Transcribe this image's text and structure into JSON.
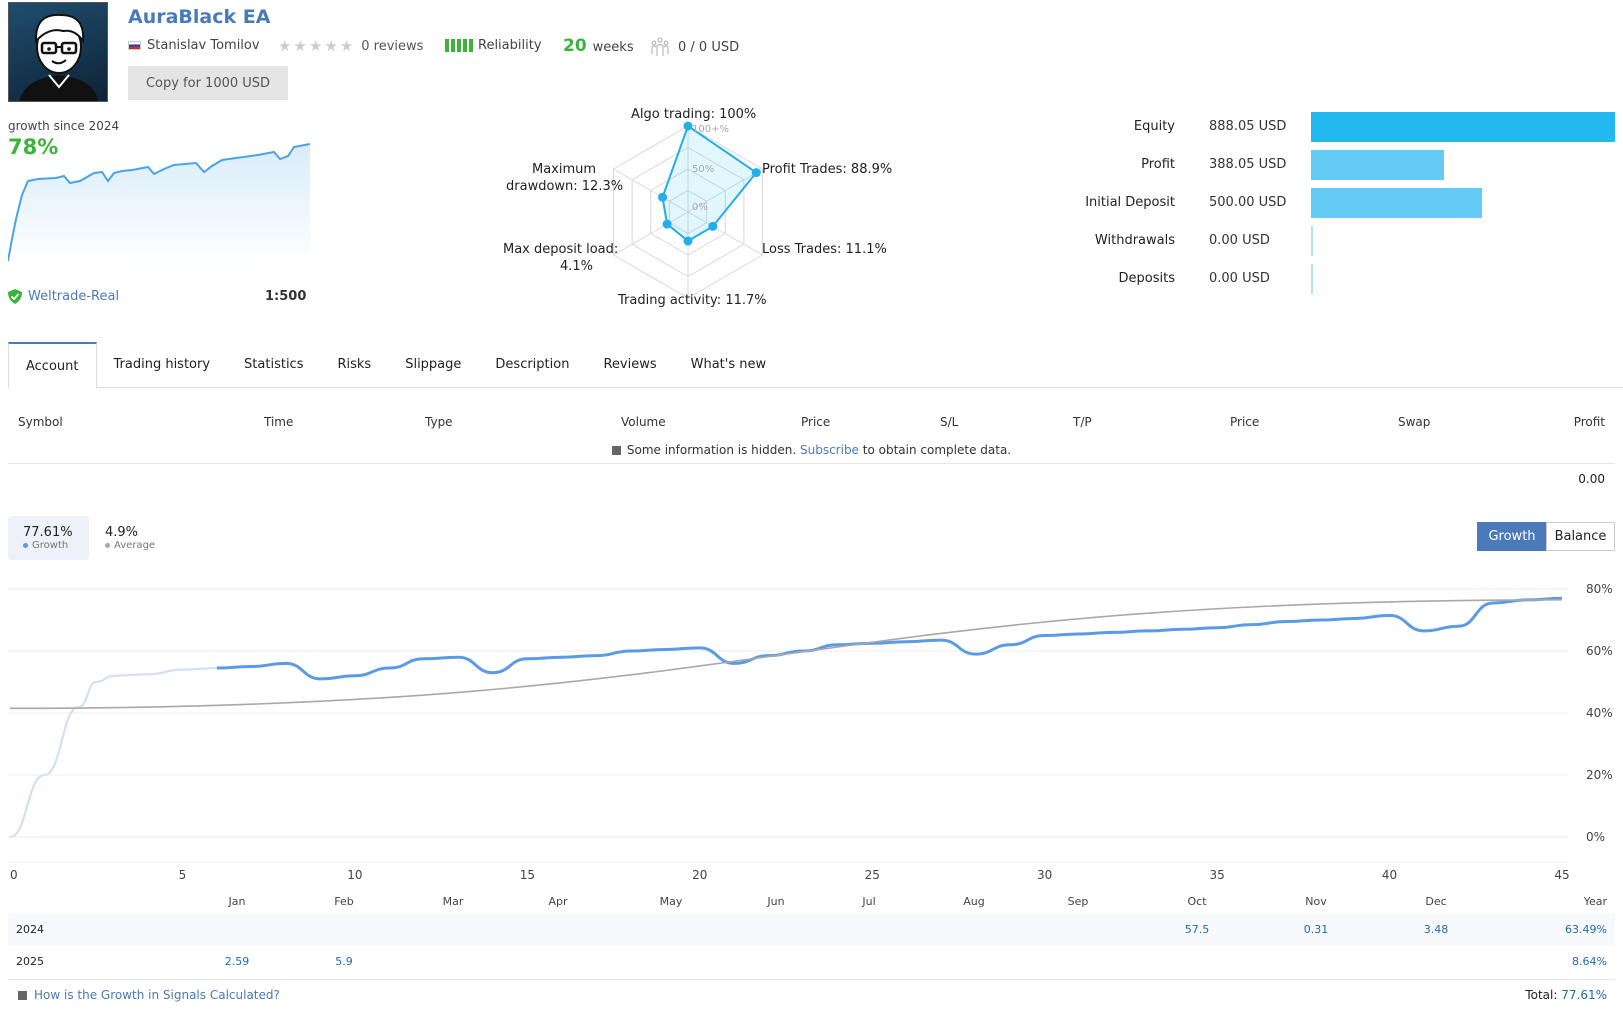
{
  "header": {
    "title": "AuraBlack EA",
    "author": "Stanislav Tomilov",
    "reviews": "0 reviews",
    "rating_stars": 0,
    "reliability_label": "Reliability",
    "reliability_bars": 5,
    "weeks_value": "20",
    "weeks_label": "weeks",
    "subscribers": "0 / 0 USD",
    "copy_button": "Copy for 1000 USD"
  },
  "summary": {
    "growth_label": "growth since 2024",
    "growth_value": "78%",
    "broker": "Weltrade-Real",
    "leverage": "1:500"
  },
  "radar": {
    "labels": {
      "algo": "Algo trading: 100%",
      "profit": "Profit Trades: 88.9%",
      "loss": "Loss Trades: 11.1%",
      "activity": "Trading activity: 11.7%",
      "load_1": "Max deposit load:",
      "load_2": "4.1%",
      "dd_1": "Maximum",
      "dd_2": "drawdown: 12.3%"
    },
    "scale": {
      "top": "100+%",
      "mid": "50%",
      "zero": "0%"
    },
    "values": {
      "algo": 100,
      "profit": 88.9,
      "loss": 11.1,
      "activity": 11.7,
      "load": 4.1,
      "drawdown": 12.3
    }
  },
  "balance_bars": [
    {
      "label": "Equity",
      "value": "888.05 USD",
      "amount": 888.05,
      "color": "#22b8f0"
    },
    {
      "label": "Profit",
      "value": "388.05 USD",
      "amount": 388.05,
      "color": "#64ccf4"
    },
    {
      "label": "Initial Deposit",
      "value": "500.00 USD",
      "amount": 500.0,
      "color": "#64ccf4"
    },
    {
      "label": "Withdrawals",
      "value": "0.00 USD",
      "amount": 0,
      "color": "#aee3f9"
    },
    {
      "label": "Deposits",
      "value": "0.00 USD",
      "amount": 0,
      "color": "#aee3f9"
    }
  ],
  "tabs": [
    "Account",
    "Trading history",
    "Statistics",
    "Risks",
    "Slippage",
    "Description",
    "Reviews",
    "What's new"
  ],
  "active_tab": 0,
  "positions": {
    "columns": [
      "Symbol",
      "Time",
      "Type",
      "Volume",
      "Price",
      "S/L",
      "T/P",
      "Price",
      "Swap",
      "Profit"
    ],
    "hidden_note_pre": "Some information is hidden.",
    "hidden_note_link": "Subscribe",
    "hidden_note_post": "to obtain complete data.",
    "profit_total": "0.00"
  },
  "growth_stats": {
    "growth_value": "77.61%",
    "growth_label": "Growth",
    "average_value": "4.9%",
    "average_label": "Average"
  },
  "chart_buttons": {
    "growth": "Growth",
    "balance": "Balance"
  },
  "chart_data": {
    "type": "line",
    "title": "",
    "xlabel": "",
    "ylabel": "",
    "x_ticks": [
      "0",
      "5",
      "10",
      "15",
      "20",
      "25",
      "30",
      "35",
      "40",
      "45"
    ],
    "y_ticks": [
      "0%",
      "20%",
      "40%",
      "60%",
      "80%"
    ],
    "xlim": [
      0,
      45
    ],
    "ylim": [
      0,
      80
    ],
    "grid": true,
    "series": [
      {
        "name": "Growth (pre-signal)",
        "color": "#d3dff5",
        "x": [
          0,
          1,
          2,
          2.5,
          3,
          4,
          5,
          6
        ],
        "y": [
          0,
          20,
          42,
          50,
          52,
          52.5,
          54,
          54.5
        ]
      },
      {
        "name": "Growth",
        "color": "#5b9be6",
        "x": [
          6,
          7,
          8,
          9,
          10,
          11,
          12,
          13,
          14,
          15,
          16,
          17,
          18,
          19,
          20,
          21,
          22,
          23,
          24,
          25,
          26,
          27,
          28,
          29,
          30,
          31,
          32,
          33,
          34,
          35,
          36,
          37,
          38,
          39,
          40,
          41,
          42,
          43,
          44,
          45
        ],
        "y": [
          54.5,
          55,
          56,
          51,
          52,
          54.5,
          57.5,
          58,
          53,
          57.5,
          58,
          58.5,
          60,
          60.5,
          61,
          56,
          58.5,
          60,
          62,
          62.5,
          63,
          63.5,
          59,
          62,
          65,
          65.5,
          66,
          66.5,
          67,
          67.5,
          68.5,
          69.5,
          70,
          70.5,
          71.5,
          66.5,
          68,
          75.5,
          76.5,
          77
        ]
      },
      {
        "name": "Average trend",
        "color": "#a8a8a8",
        "x": [
          0,
          45
        ],
        "y": [
          41.5,
          76.5
        ]
      }
    ]
  },
  "monthly": {
    "months": [
      "Jan",
      "Feb",
      "Mar",
      "Apr",
      "May",
      "Jun",
      "Jul",
      "Aug",
      "Sep",
      "Oct",
      "Nov",
      "Dec"
    ],
    "year_header": "Year",
    "rows": [
      {
        "year": "2024",
        "values": [
          "",
          "",
          "",
          "",
          "",
          "",
          "",
          "",
          "",
          "57.5",
          "0.31",
          "3.48"
        ],
        "total": "63.49%"
      },
      {
        "year": "2025",
        "values": [
          "2.59",
          "5.9",
          "",
          "",
          "",
          "",
          "",
          "",
          "",
          "",
          "",
          ""
        ],
        "total": "8.64%"
      }
    ],
    "total_label": "Total:",
    "total_value": "77.61%",
    "help_link": "How is the Growth in Signals Calculated?"
  }
}
